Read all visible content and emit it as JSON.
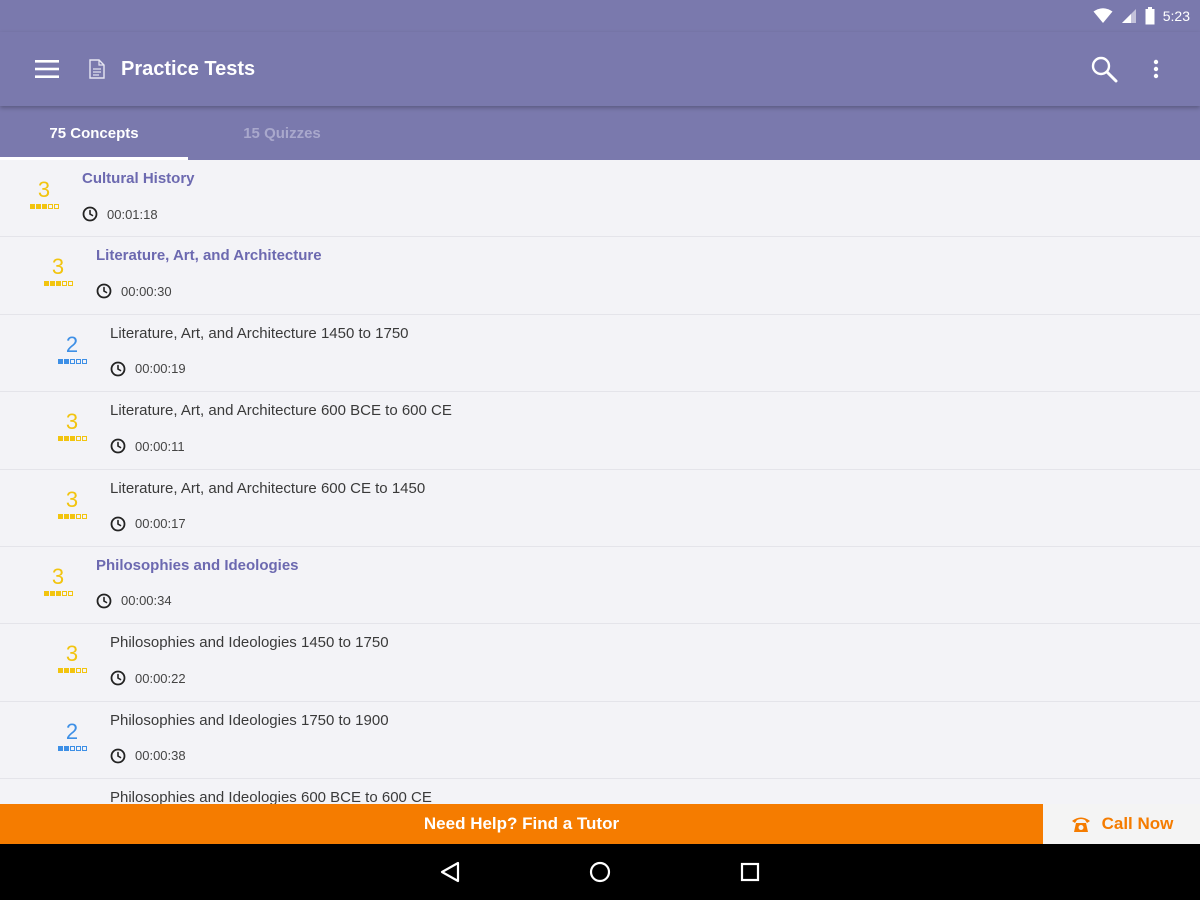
{
  "status_bar": {
    "time": "5:23"
  },
  "app_bar": {
    "title": "Practice Tests",
    "menu_icon": "hamburger-menu-icon",
    "title_icon": "document-icon",
    "actions": [
      "search-icon",
      "overflow-menu-icon"
    ]
  },
  "tabs": [
    {
      "label": "75 Concepts",
      "active": true
    },
    {
      "label": "15 Quizzes",
      "active": false
    }
  ],
  "colors": {
    "primary": "#7a79ad",
    "section_title": "#6c69b0",
    "accent_orange": "#f57c00",
    "level_yellow": "#f2c40f",
    "level_blue": "#3d8fe6"
  },
  "concepts": [
    {
      "level": 0,
      "section": true,
      "title": "Cultural History",
      "time": "00:01:18",
      "score": "3",
      "color": "#f2c40f",
      "filled": 3
    },
    {
      "level": 1,
      "section": true,
      "title": "Literature, Art, and Architecture",
      "time": "00:00:30",
      "score": "3",
      "color": "#f2c40f",
      "filled": 3
    },
    {
      "level": 2,
      "section": false,
      "title": "Literature, Art, and Architecture 1450 to 1750",
      "time": "00:00:19",
      "score": "2",
      "color": "#3d8fe6",
      "filled": 2
    },
    {
      "level": 2,
      "section": false,
      "title": "Literature, Art, and Architecture 600 BCE to 600 CE",
      "time": "00:00:11",
      "score": "3",
      "color": "#f2c40f",
      "filled": 3
    },
    {
      "level": 2,
      "section": false,
      "title": "Literature, Art, and Architecture 600 CE to 1450",
      "time": "00:00:17",
      "score": "3",
      "color": "#f2c40f",
      "filled": 3
    },
    {
      "level": 1,
      "section": true,
      "title": "Philosophies and Ideologies",
      "time": "00:00:34",
      "score": "3",
      "color": "#f2c40f",
      "filled": 3
    },
    {
      "level": 2,
      "section": false,
      "title": "Philosophies and Ideologies 1450 to 1750",
      "time": "00:00:22",
      "score": "3",
      "color": "#f2c40f",
      "filled": 3
    },
    {
      "level": 2,
      "section": false,
      "title": "Philosophies and Ideologies 1750 to 1900",
      "time": "00:00:38",
      "score": "2",
      "color": "#3d8fe6",
      "filled": 2
    },
    {
      "level": 2,
      "section": false,
      "title": "Philosophies and Ideologies 600 BCE to 600 CE",
      "time": "",
      "score": "",
      "color": "#f2c40f",
      "filled": 0
    }
  ],
  "help_bar": {
    "label": "Need Help? Find a Tutor",
    "call_label": "Call Now",
    "call_icon": "phone-icon"
  },
  "nav_bar": [
    "back-icon",
    "home-icon",
    "recents-icon"
  ]
}
